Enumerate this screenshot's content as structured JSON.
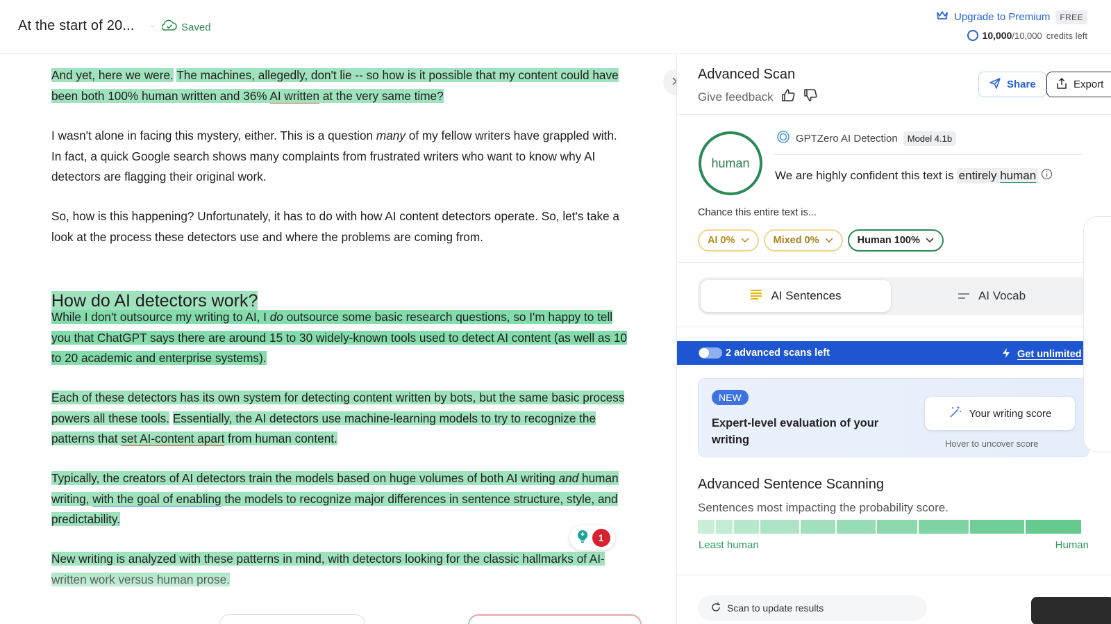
{
  "header": {
    "doc_title": "At the start of 20...",
    "separator": "-",
    "saved_label": "Saved",
    "upgrade_label": "Upgrade to Premium",
    "plan_badge": "FREE",
    "credits_used": "10,000",
    "credits_total": "/10,000",
    "credits_suffix": "credits left"
  },
  "editor": {
    "p1_a": "And yet, here we were.",
    "p1_b": "The machines, allegedly, don't lie -- so how is it possible that my content could have been both 100% human written and 36%",
    "p1_c": "AI written",
    "p1_d": "at the very same time?",
    "p2_a": "I wasn't alone in facing this mystery, either. This is a question",
    "p2_em": "many",
    "p2_b": "of my fellow writers have grappled with. In fact, a quick Google search shows many complaints from frustrated writers who want to know why AI detectors are flagging their original work.",
    "p3": "So, how is this happening? Unfortunately, it has to do with how AI content detectors operate. So, let's take a look at the process these detectors use and where the problems are coming from.",
    "heading": "How do AI detectors work?",
    "p4_a": "While I don't outsource my writing to AI, I",
    "p4_em": "do",
    "p4_b": "outsource some basic research questions, so I'm happy to tell you that ChatGPT says there are around 15 to 30 widely-known tools used to detect AI content (as well as 10 to 20 academic and enterprise systems).",
    "p5_a": "Each of these detectors has its own system for detecting content written by bots, but the same basic process powers all these tools.",
    "p5_b": "Essentially, the AI detectors use machine-learning models to try to recognize the patterns that",
    "p5_c": "set AI-content apart",
    "p5_d": "from human content.",
    "p6_a": "Typically, the creators of AI detectors train the models based on huge volumes of both AI writing",
    "p6_em": "and",
    "p6_b": "human writing,",
    "p6_c": "with the goal of enabling",
    "p6_d": "the models to recognize major differences in sentence structure, style, and predictability.",
    "p7": "New writing is analyzed with these patterns in mind, with detectors looking for the classic hallmarks of AI-written work versus human prose.",
    "suggestion_count": "1"
  },
  "panel": {
    "title": "Advanced Scan",
    "feedback_label": "Give feedback",
    "share_label": "Share",
    "export_label": "Export",
    "result_label": "human",
    "detector_name": "GPTZero AI Detection",
    "model_badge": "Model 4.1b",
    "confidence_prefix": "We are highly confident this text is",
    "confidence_word1": "entirely",
    "confidence_word2": "human",
    "chance_label": "Chance this entire text is...",
    "pills": [
      {
        "label": "AI 0%"
      },
      {
        "label": "Mixed 0%"
      },
      {
        "label": "Human 100%"
      }
    ],
    "tabs": [
      {
        "label": "AI Sentences"
      },
      {
        "label": "AI Vocab"
      }
    ],
    "scans_left": "2 advanced scans left",
    "get_unlimited": "Get unlimited",
    "promo_badge": "NEW",
    "promo_text": "Expert-level evaluation of your writing",
    "score_button": "Your writing score",
    "hover_hint": "Hover to uncover score",
    "adv_title": "Advanced Sentence Scanning",
    "adv_sub": "Sentences most impacting the probability score.",
    "scale_low": "Least human",
    "scale_high": "Human",
    "update_label": "Scan to update results"
  },
  "colors": {
    "highlight": "#9fe2bd",
    "accent_blue": "#1e55d0",
    "human_green": "#2b8a55",
    "ai_yellow": "#f0d58e"
  },
  "icons": [
    "saved-check-icon",
    "crown-icon",
    "credits-ring-icon",
    "collapse-chevrons-icon",
    "thumbs-up-icon",
    "thumbs-down-icon",
    "send-icon",
    "export-icon",
    "gptzero-logo-icon",
    "info-icon",
    "chevron-down-icon",
    "sentences-icon",
    "vocab-icon",
    "toggle-icon",
    "lightning-icon",
    "magic-wand-icon",
    "suggestion-bulb-icon",
    "refresh-icon"
  ]
}
